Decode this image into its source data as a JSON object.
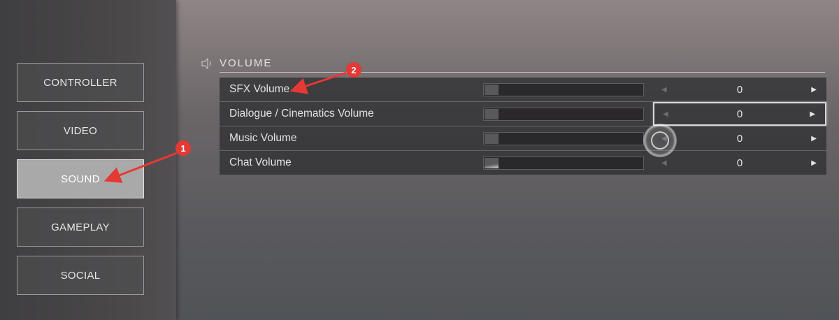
{
  "colors": {
    "annotation": "#e53935",
    "active_tab": "#a9a9aa",
    "text": "#e2e2e2"
  },
  "sidebar": {
    "items": [
      {
        "label": "CONTROLLER",
        "active": false
      },
      {
        "label": "VIDEO",
        "active": false
      },
      {
        "label": "SOUND",
        "active": true
      },
      {
        "label": "GAMEPLAY",
        "active": false
      },
      {
        "label": "SOCIAL",
        "active": false
      }
    ]
  },
  "section": {
    "icon": "speaker-icon",
    "title": "VOLUME"
  },
  "settings": [
    {
      "label": "SFX Volume",
      "value": "0",
      "slider_level": 0
    },
    {
      "label": "Dialogue / Cinematics Volume",
      "value": "0",
      "slider_level": 0
    },
    {
      "label": "Music Volume",
      "value": "0",
      "slider_level": 0
    },
    {
      "label": "Chat Volume",
      "value": "0",
      "slider_level": 0
    }
  ],
  "arrows": {
    "left": "◀",
    "right": "▶"
  },
  "annotations": [
    {
      "number": "1",
      "target": "SOUND"
    },
    {
      "number": "2",
      "target": "SFX Volume"
    }
  ]
}
